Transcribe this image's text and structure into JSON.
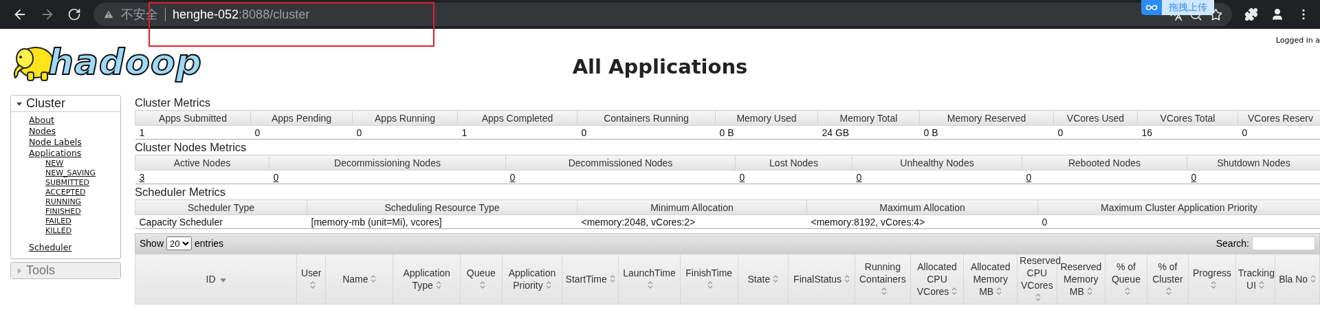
{
  "browser": {
    "warning": "不安全",
    "host": "henghe-052",
    "path": ":8088/cluster",
    "upload_popup": "拖拽上传"
  },
  "header": {
    "logo_text": "hadoop",
    "title": "All Applications",
    "logged_in": "Logged in a"
  },
  "sidebar": [
    {
      "label": "Cluster",
      "expanded": true,
      "items": [
        {
          "label": "About"
        },
        {
          "label": "Nodes"
        },
        {
          "label": "Node Labels"
        },
        {
          "label": "Applications",
          "children": [
            {
              "label": "NEW"
            },
            {
              "label": "NEW_SAVING"
            },
            {
              "label": "SUBMITTED"
            },
            {
              "label": "ACCEPTED"
            },
            {
              "label": "RUNNING"
            },
            {
              "label": "FINISHED"
            },
            {
              "label": "FAILED"
            },
            {
              "label": "KILLED"
            }
          ]
        },
        {
          "label": "Scheduler"
        }
      ]
    },
    {
      "label": "Tools",
      "expanded": false
    }
  ],
  "cluster_metrics": {
    "title": "Cluster Metrics",
    "columns": [
      "Apps Submitted",
      "Apps Pending",
      "Apps Running",
      "Apps Completed",
      "Containers Running",
      "Memory Used",
      "Memory Total",
      "Memory Reserved",
      "VCores Used",
      "VCores Total",
      "VCores Reserv"
    ],
    "values": [
      "1",
      "0",
      "0",
      "1",
      "0",
      "0 B",
      "24 GB",
      "0 B",
      "0",
      "16",
      "0"
    ]
  },
  "nodes_metrics": {
    "title": "Cluster Nodes Metrics",
    "columns": [
      "Active Nodes",
      "Decommissioning Nodes",
      "Decommissioned Nodes",
      "Lost Nodes",
      "Unhealthy Nodes",
      "Rebooted Nodes",
      "Shutdown Nodes"
    ],
    "values": [
      "3",
      "0",
      "0",
      "0",
      "0",
      "0",
      "0"
    ]
  },
  "scheduler_metrics": {
    "title": "Scheduler Metrics",
    "columns": [
      "Scheduler Type",
      "Scheduling Resource Type",
      "Minimum Allocation",
      "Maximum Allocation",
      "Maximum Cluster Application Priority"
    ],
    "values": [
      "Capacity Scheduler",
      "[memory-mb (unit=Mi), vcores]",
      "<memory:2048, vCores:2>",
      "<memory:8192, vCores:4>",
      "0"
    ]
  },
  "apps_table": {
    "show_label": "Show",
    "page_size": "20",
    "entries_label": "entries",
    "search_label": "Search:",
    "columns": [
      {
        "label": "ID",
        "sorted": true
      },
      {
        "label": "User",
        "sorted": false
      },
      {
        "label": "Name",
        "sorted": false
      },
      {
        "label": "Application Type",
        "sorted": false
      },
      {
        "label": "Queue",
        "sorted": false
      },
      {
        "label": "Application Priority",
        "sorted": false
      },
      {
        "label": "StartTime",
        "sorted": false
      },
      {
        "label": "LaunchTime",
        "sorted": false
      },
      {
        "label": "FinishTime",
        "sorted": false
      },
      {
        "label": "State",
        "sorted": false
      },
      {
        "label": "FinalStatus",
        "sorted": false
      },
      {
        "label": "Running Containers",
        "sorted": false
      },
      {
        "label": "Allocated CPU VCores",
        "sorted": false
      },
      {
        "label": "Allocated Memory MB",
        "sorted": false
      },
      {
        "label": "Reserved CPU VCores",
        "sorted": false
      },
      {
        "label": "Reserved Memory MB",
        "sorted": false
      },
      {
        "label": "% of Queue",
        "sorted": false
      },
      {
        "label": "% of Cluster",
        "sorted": false
      },
      {
        "label": "Progress",
        "sorted": false
      },
      {
        "label": "Tracking UI",
        "sorted": false
      },
      {
        "label": "Bla No",
        "sorted": false
      }
    ]
  }
}
